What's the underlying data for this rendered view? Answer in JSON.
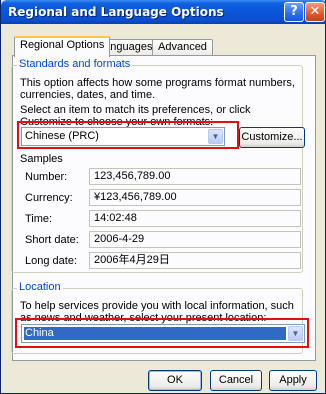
{
  "window": {
    "title": "Regional and Language Options"
  },
  "titlebar_buttons": {
    "help": "?",
    "close": "✕"
  },
  "tabs": [
    {
      "label": "Regional Options",
      "active": true
    },
    {
      "label": "Languages",
      "active": false
    },
    {
      "label": "Advanced",
      "active": false
    }
  ],
  "standards": {
    "title": "Standards and formats",
    "description": "This option affects how some programs format numbers, currencies, dates, and time.",
    "instruction": "Select an item to match its preferences, or click Customize to choose your own formats:",
    "selected_locale": "Chinese (PRC)",
    "customize_label": "Customize...",
    "samples_label": "Samples",
    "samples": [
      {
        "label": "Number:",
        "value": "123,456,789.00"
      },
      {
        "label": "Currency:",
        "value": "¥123,456,789.00"
      },
      {
        "label": "Time:",
        "value": "14:02:48"
      },
      {
        "label": "Short date:",
        "value": "2006-4-29"
      },
      {
        "label": "Long date:",
        "value": "2006年4月29日"
      }
    ]
  },
  "location": {
    "title": "Location",
    "description": "To help services provide you with local information, such as news and weather, select your present location:",
    "selected_location": "China"
  },
  "footer": {
    "ok_label": "OK",
    "cancel_label": "Cancel",
    "apply_label": "Apply"
  },
  "colors": {
    "titlebar": "#0a55d8",
    "group_title": "#0046d5",
    "highlight_box": "#e01010",
    "selection": "#316ac5"
  },
  "icons": {
    "dropdown": "chevron-down-icon"
  }
}
